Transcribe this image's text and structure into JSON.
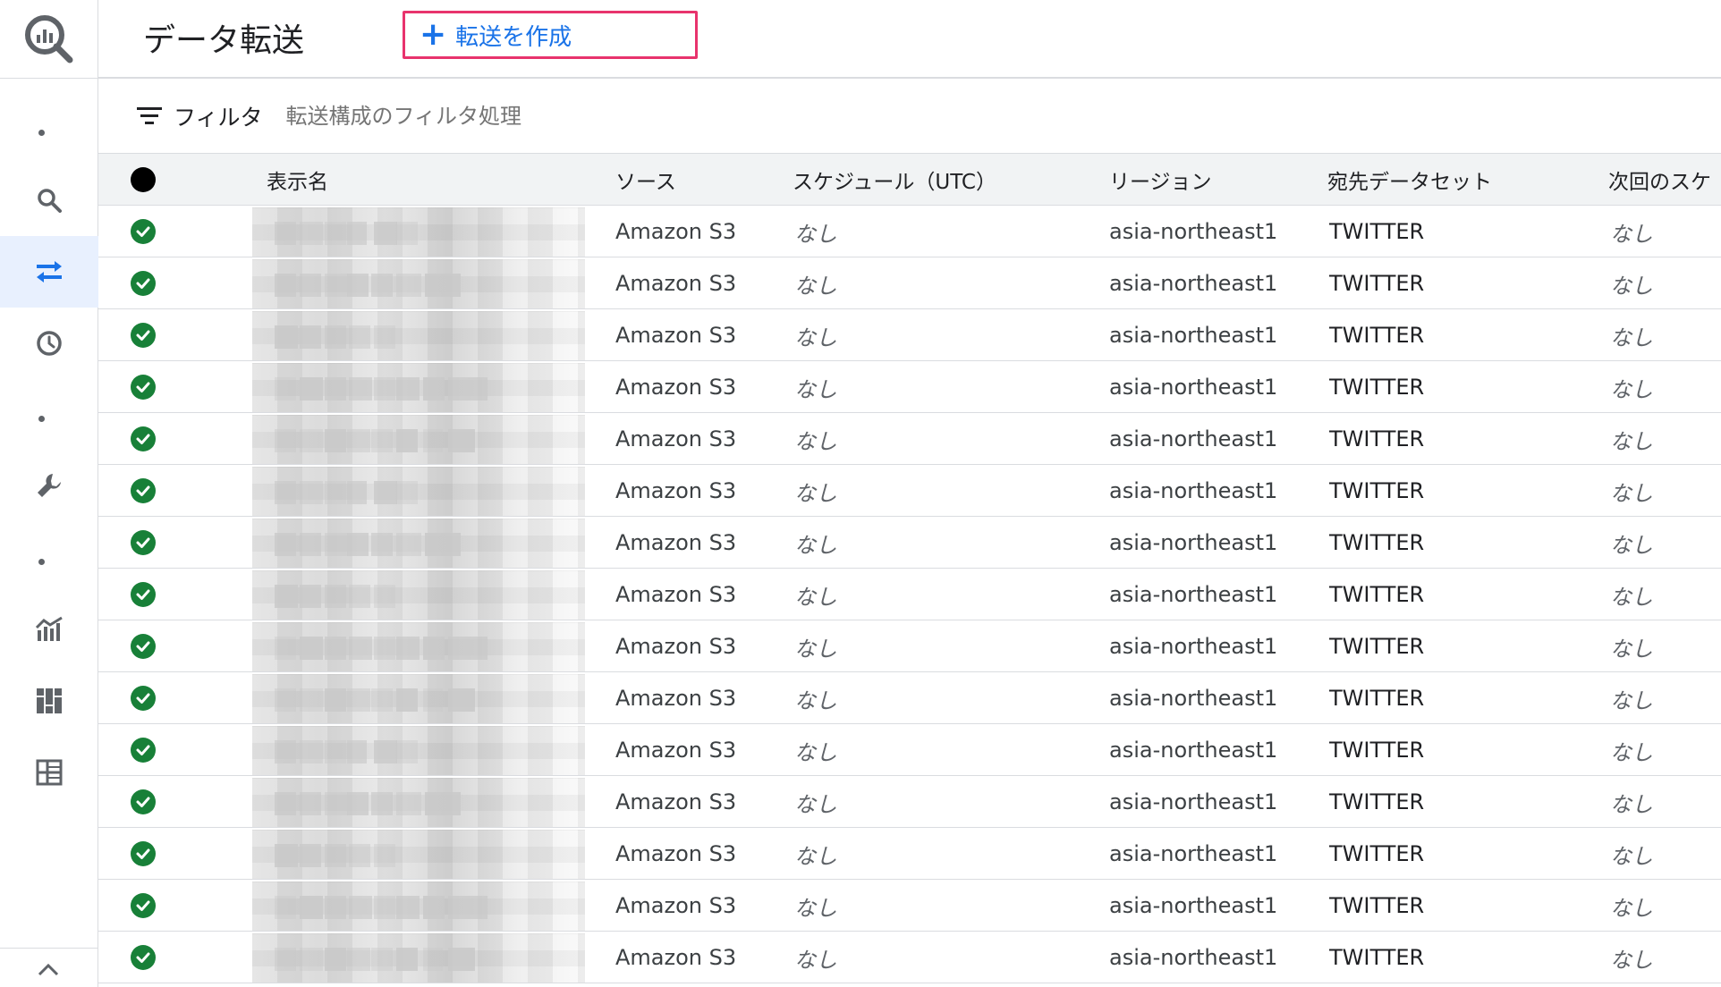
{
  "header": {
    "title": "データ転送",
    "create_label": "転送を作成"
  },
  "filter": {
    "label": "フィルタ",
    "placeholder": "転送構成のフィルタ処理"
  },
  "rail": {
    "items": [
      "dot",
      "search-icon",
      "transfer-icon",
      "history-icon",
      "dot",
      "wrench-icon",
      "dot",
      "monitoring-icon",
      "dashboard-icon",
      "reservations-icon"
    ]
  },
  "table": {
    "columns": [
      "表示名",
      "ソース",
      "スケジュール（UTC）",
      "リージョン",
      "宛先データセット",
      "次回のスケ"
    ],
    "rows": [
      {
        "display_name": "",
        "source": "Amazon S3",
        "schedule": "なし",
        "region": "asia-northeast1",
        "dataset": "TWITTER",
        "next": "なし"
      },
      {
        "display_name": "",
        "source": "Amazon S3",
        "schedule": "なし",
        "region": "asia-northeast1",
        "dataset": "TWITTER",
        "next": "なし"
      },
      {
        "display_name": "",
        "source": "Amazon S3",
        "schedule": "なし",
        "region": "asia-northeast1",
        "dataset": "TWITTER",
        "next": "なし"
      },
      {
        "display_name": "",
        "source": "Amazon S3",
        "schedule": "なし",
        "region": "asia-northeast1",
        "dataset": "TWITTER",
        "next": "なし"
      },
      {
        "display_name": "",
        "source": "Amazon S3",
        "schedule": "なし",
        "region": "asia-northeast1",
        "dataset": "TWITTER",
        "next": "なし"
      },
      {
        "display_name": "",
        "source": "Amazon S3",
        "schedule": "なし",
        "region": "asia-northeast1",
        "dataset": "TWITTER",
        "next": "なし"
      },
      {
        "display_name": "",
        "source": "Amazon S3",
        "schedule": "なし",
        "region": "asia-northeast1",
        "dataset": "TWITTER",
        "next": "なし"
      },
      {
        "display_name": "",
        "source": "Amazon S3",
        "schedule": "なし",
        "region": "asia-northeast1",
        "dataset": "TWITTER",
        "next": "なし"
      },
      {
        "display_name": "",
        "source": "Amazon S3",
        "schedule": "なし",
        "region": "asia-northeast1",
        "dataset": "TWITTER",
        "next": "なし"
      },
      {
        "display_name": "",
        "source": "Amazon S3",
        "schedule": "なし",
        "region": "asia-northeast1",
        "dataset": "TWITTER",
        "next": "なし"
      },
      {
        "display_name": "",
        "source": "Amazon S3",
        "schedule": "なし",
        "region": "asia-northeast1",
        "dataset": "TWITTER",
        "next": "なし"
      },
      {
        "display_name": "",
        "source": "Amazon S3",
        "schedule": "なし",
        "region": "asia-northeast1",
        "dataset": "TWITTER",
        "next": "なし"
      },
      {
        "display_name": "",
        "source": "Amazon S3",
        "schedule": "なし",
        "region": "asia-northeast1",
        "dataset": "TWITTER",
        "next": "なし"
      },
      {
        "display_name": "",
        "source": "Amazon S3",
        "schedule": "なし",
        "region": "asia-northeast1",
        "dataset": "TWITTER",
        "next": "なし"
      },
      {
        "display_name": "",
        "source": "Amazon S3",
        "schedule": "なし",
        "region": "asia-northeast1",
        "dataset": "TWITTER",
        "next": "なし"
      }
    ]
  },
  "colors": {
    "accent": "#1a73e8",
    "highlight_border": "#e8336d",
    "status_ok": "#188038"
  }
}
